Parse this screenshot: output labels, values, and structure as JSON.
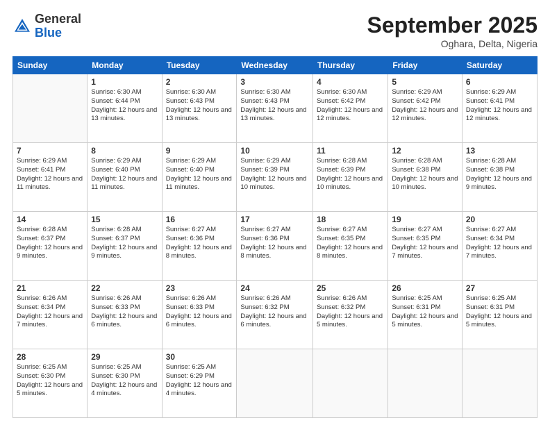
{
  "header": {
    "logo_general": "General",
    "logo_blue": "Blue",
    "month": "September 2025",
    "location": "Oghara, Delta, Nigeria"
  },
  "columns": [
    "Sunday",
    "Monday",
    "Tuesday",
    "Wednesday",
    "Thursday",
    "Friday",
    "Saturday"
  ],
  "weeks": [
    [
      {
        "day": "",
        "info": ""
      },
      {
        "day": "1",
        "info": "Sunrise: 6:30 AM\nSunset: 6:44 PM\nDaylight: 12 hours\nand 13 minutes."
      },
      {
        "day": "2",
        "info": "Sunrise: 6:30 AM\nSunset: 6:43 PM\nDaylight: 12 hours\nand 13 minutes."
      },
      {
        "day": "3",
        "info": "Sunrise: 6:30 AM\nSunset: 6:43 PM\nDaylight: 12 hours\nand 13 minutes."
      },
      {
        "day": "4",
        "info": "Sunrise: 6:30 AM\nSunset: 6:42 PM\nDaylight: 12 hours\nand 12 minutes."
      },
      {
        "day": "5",
        "info": "Sunrise: 6:29 AM\nSunset: 6:42 PM\nDaylight: 12 hours\nand 12 minutes."
      },
      {
        "day": "6",
        "info": "Sunrise: 6:29 AM\nSunset: 6:41 PM\nDaylight: 12 hours\nand 12 minutes."
      }
    ],
    [
      {
        "day": "7",
        "info": "Sunrise: 6:29 AM\nSunset: 6:41 PM\nDaylight: 12 hours\nand 11 minutes."
      },
      {
        "day": "8",
        "info": "Sunrise: 6:29 AM\nSunset: 6:40 PM\nDaylight: 12 hours\nand 11 minutes."
      },
      {
        "day": "9",
        "info": "Sunrise: 6:29 AM\nSunset: 6:40 PM\nDaylight: 12 hours\nand 11 minutes."
      },
      {
        "day": "10",
        "info": "Sunrise: 6:29 AM\nSunset: 6:39 PM\nDaylight: 12 hours\nand 10 minutes."
      },
      {
        "day": "11",
        "info": "Sunrise: 6:28 AM\nSunset: 6:39 PM\nDaylight: 12 hours\nand 10 minutes."
      },
      {
        "day": "12",
        "info": "Sunrise: 6:28 AM\nSunset: 6:38 PM\nDaylight: 12 hours\nand 10 minutes."
      },
      {
        "day": "13",
        "info": "Sunrise: 6:28 AM\nSunset: 6:38 PM\nDaylight: 12 hours\nand 9 minutes."
      }
    ],
    [
      {
        "day": "14",
        "info": "Sunrise: 6:28 AM\nSunset: 6:37 PM\nDaylight: 12 hours\nand 9 minutes."
      },
      {
        "day": "15",
        "info": "Sunrise: 6:28 AM\nSunset: 6:37 PM\nDaylight: 12 hours\nand 9 minutes."
      },
      {
        "day": "16",
        "info": "Sunrise: 6:27 AM\nSunset: 6:36 PM\nDaylight: 12 hours\nand 8 minutes."
      },
      {
        "day": "17",
        "info": "Sunrise: 6:27 AM\nSunset: 6:36 PM\nDaylight: 12 hours\nand 8 minutes."
      },
      {
        "day": "18",
        "info": "Sunrise: 6:27 AM\nSunset: 6:35 PM\nDaylight: 12 hours\nand 8 minutes."
      },
      {
        "day": "19",
        "info": "Sunrise: 6:27 AM\nSunset: 6:35 PM\nDaylight: 12 hours\nand 7 minutes."
      },
      {
        "day": "20",
        "info": "Sunrise: 6:27 AM\nSunset: 6:34 PM\nDaylight: 12 hours\nand 7 minutes."
      }
    ],
    [
      {
        "day": "21",
        "info": "Sunrise: 6:26 AM\nSunset: 6:34 PM\nDaylight: 12 hours\nand 7 minutes."
      },
      {
        "day": "22",
        "info": "Sunrise: 6:26 AM\nSunset: 6:33 PM\nDaylight: 12 hours\nand 6 minutes."
      },
      {
        "day": "23",
        "info": "Sunrise: 6:26 AM\nSunset: 6:33 PM\nDaylight: 12 hours\nand 6 minutes."
      },
      {
        "day": "24",
        "info": "Sunrise: 6:26 AM\nSunset: 6:32 PM\nDaylight: 12 hours\nand 6 minutes."
      },
      {
        "day": "25",
        "info": "Sunrise: 6:26 AM\nSunset: 6:32 PM\nDaylight: 12 hours\nand 5 minutes."
      },
      {
        "day": "26",
        "info": "Sunrise: 6:25 AM\nSunset: 6:31 PM\nDaylight: 12 hours\nand 5 minutes."
      },
      {
        "day": "27",
        "info": "Sunrise: 6:25 AM\nSunset: 6:31 PM\nDaylight: 12 hours\nand 5 minutes."
      }
    ],
    [
      {
        "day": "28",
        "info": "Sunrise: 6:25 AM\nSunset: 6:30 PM\nDaylight: 12 hours\nand 5 minutes."
      },
      {
        "day": "29",
        "info": "Sunrise: 6:25 AM\nSunset: 6:30 PM\nDaylight: 12 hours\nand 4 minutes."
      },
      {
        "day": "30",
        "info": "Sunrise: 6:25 AM\nSunset: 6:29 PM\nDaylight: 12 hours\nand 4 minutes."
      },
      {
        "day": "",
        "info": ""
      },
      {
        "day": "",
        "info": ""
      },
      {
        "day": "",
        "info": ""
      },
      {
        "day": "",
        "info": ""
      }
    ]
  ]
}
